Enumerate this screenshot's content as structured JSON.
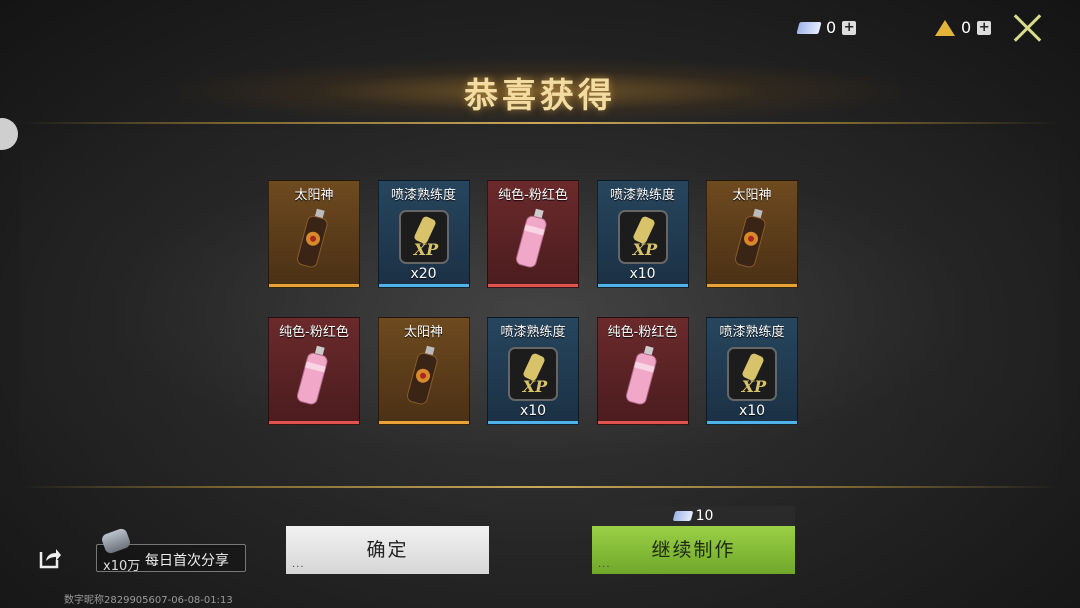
{
  "header": {
    "ticket_count": "0",
    "tri_count": "0",
    "plus_symbol": "+",
    "title": "恭喜获得"
  },
  "items": [
    {
      "name": "太阳神",
      "rarity": "orange",
      "kind": "spray-sun",
      "qty": ""
    },
    {
      "name": "喷漆熟练度",
      "rarity": "blue",
      "kind": "xp",
      "qty": "x20"
    },
    {
      "name": "纯色-粉红色",
      "rarity": "red",
      "kind": "spray-pink",
      "qty": ""
    },
    {
      "name": "喷漆熟练度",
      "rarity": "blue",
      "kind": "xp",
      "qty": "x10"
    },
    {
      "name": "太阳神",
      "rarity": "orange",
      "kind": "spray-sun",
      "qty": ""
    },
    {
      "name": "纯色-粉红色",
      "rarity": "red",
      "kind": "spray-pink",
      "qty": ""
    },
    {
      "name": "太阳神",
      "rarity": "orange",
      "kind": "spray-sun",
      "qty": ""
    },
    {
      "name": "喷漆熟练度",
      "rarity": "blue",
      "kind": "xp",
      "qty": "x10"
    },
    {
      "name": "纯色-粉红色",
      "rarity": "red",
      "kind": "spray-pink",
      "qty": ""
    },
    {
      "name": "喷漆熟练度",
      "rarity": "blue",
      "kind": "xp",
      "qty": "x10"
    }
  ],
  "share": {
    "amount": "x10万",
    "label": "每日首次分享"
  },
  "buttons": {
    "confirm": "确定",
    "continue": "继续制作",
    "continue_cost": "10",
    "dots": "..."
  },
  "footer": {
    "note": "数字昵称2829905607-06-08-01:13"
  },
  "colors": {
    "orange": "#e9a236",
    "blue": "#4fb3ea",
    "red": "#e0534f",
    "green_button": "#8cc63f",
    "title_gold": "#f3dca2"
  }
}
